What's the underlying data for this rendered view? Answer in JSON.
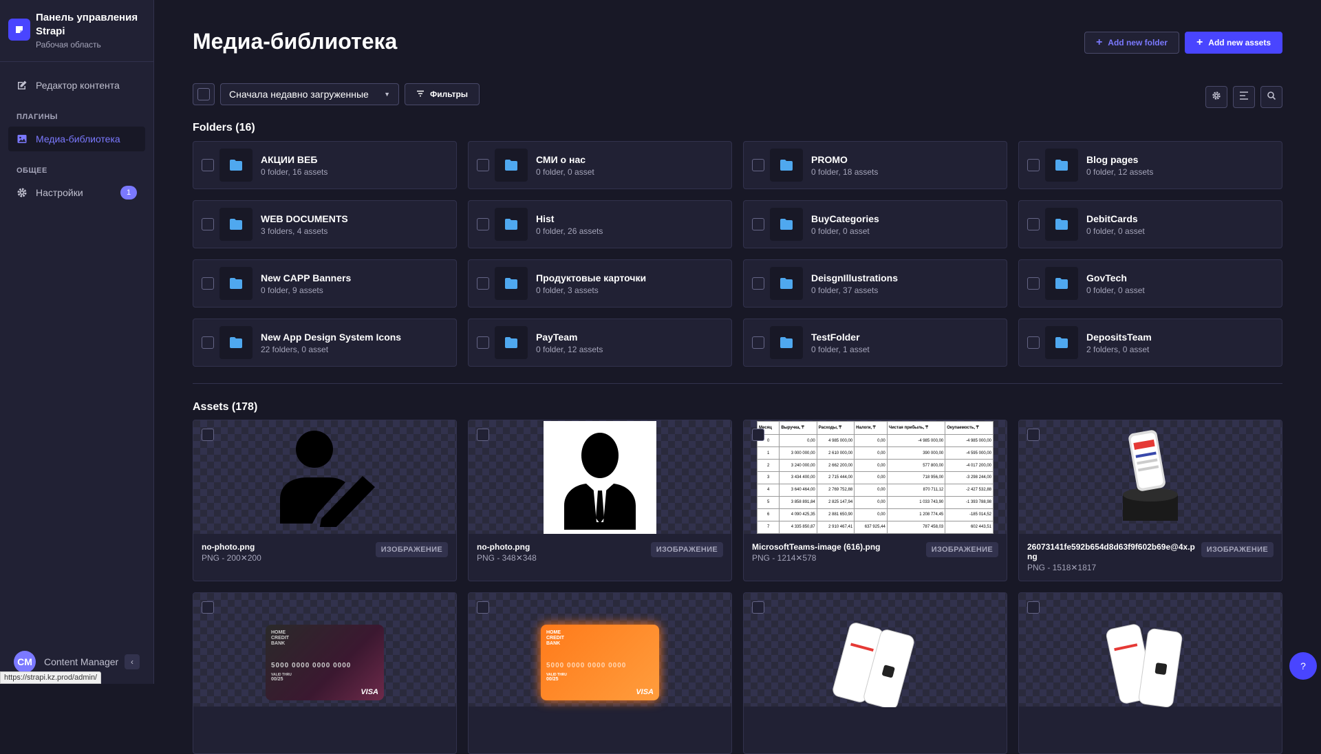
{
  "sidebar": {
    "brand_title": "Панель управления Strapi",
    "brand_subtitle": "Рабочая область",
    "content_editor": "Редактор контента",
    "section_plugins": "ПЛАГИНЫ",
    "media_library": "Медиа-библиотека",
    "section_general": "ОБЩЕЕ",
    "settings": "Настройки",
    "settings_badge": "1",
    "user_initials": "CM",
    "user_name": "Content Manager"
  },
  "status_url": "https://strapi.kz.prod/admin/",
  "header": {
    "title": "Медиа-библиотека",
    "add_folder": "Add new folder",
    "add_assets": "Add new assets"
  },
  "toolbar": {
    "sort_value": "Сначала недавно загруженные",
    "filters": "Фильтры"
  },
  "folders_title": "Folders (16)",
  "folders": [
    {
      "name": "АКЦИИ ВЕБ",
      "meta": "0 folder, 16 assets"
    },
    {
      "name": "СМИ о нас",
      "meta": "0 folder, 0 asset"
    },
    {
      "name": "PROMO",
      "meta": "0 folder, 18 assets"
    },
    {
      "name": "Blog pages",
      "meta": "0 folder, 12 assets"
    },
    {
      "name": "WEB DOCUMENTS",
      "meta": "3 folders, 4 assets"
    },
    {
      "name": "Hist",
      "meta": "0 folder, 26 assets"
    },
    {
      "name": "BuyCategories",
      "meta": "0 folder, 0 asset"
    },
    {
      "name": "DebitCards",
      "meta": "0 folder, 0 asset"
    },
    {
      "name": "New CAPP Banners",
      "meta": "0 folder, 9 assets"
    },
    {
      "name": "Продуктовые карточки",
      "meta": "0 folder, 3 assets"
    },
    {
      "name": "DeisgnIllustrations",
      "meta": "0 folder, 37 assets"
    },
    {
      "name": "GovTech",
      "meta": "0 folder, 0 asset"
    },
    {
      "name": "New App Design System Icons",
      "meta": "22 folders, 0 asset"
    },
    {
      "name": "PayTeam",
      "meta": "0 folder, 12 assets"
    },
    {
      "name": "TestFolder",
      "meta": "0 folder, 1 asset"
    },
    {
      "name": "DepositsTeam",
      "meta": "2 folders, 0 asset"
    }
  ],
  "assets_title": "Assets (178)",
  "assets": [
    {
      "name": "no-photo.png",
      "meta": "PNG - 200✕200",
      "tag": "ИЗОБРАЖЕНИЕ"
    },
    {
      "name": "no-photo.png",
      "meta": "PNG - 348✕348",
      "tag": "ИЗОБРАЖЕНИЕ"
    },
    {
      "name": "MicrosoftTeams-image (616).png",
      "meta": "PNG - 1214✕578",
      "tag": "ИЗОБРАЖЕНИЕ"
    },
    {
      "name": "26073141fe592b654d8d63f9f602b69e@4x.png",
      "meta": "PNG - 1518✕1817",
      "tag": "ИЗОБРАЖЕНИЕ"
    }
  ],
  "table_preview": {
    "headers": [
      "Месяц",
      "Выручка, ₸",
      "Расходы, ₸",
      "Налоги, ₸",
      "Чистая прибыль, ₸",
      "Окупаемость, ₸"
    ],
    "rows": [
      [
        "0",
        "0,00",
        "4 985 000,00",
        "0,00",
        "-4 985 000,00",
        "-4 985 000,00"
      ],
      [
        "1",
        "3 000 000,00",
        "2 610 000,00",
        "0,00",
        "390 000,00",
        "-4 595 000,00"
      ],
      [
        "2",
        "3 240 000,00",
        "2 662 200,00",
        "0,00",
        "577 800,00",
        "-4 017 200,00"
      ],
      [
        "3",
        "3 434 400,00",
        "2 715 444,00",
        "0,00",
        "718 956,00",
        "-3 298 244,00"
      ],
      [
        "4",
        "3 640 464,00",
        "2 769 752,88",
        "0,00",
        "870 711,12",
        "-2 427 532,88"
      ],
      [
        "5",
        "3 858 891,84",
        "2 825 147,94",
        "0,00",
        "1 033 743,90",
        "-1 393 788,98"
      ],
      [
        "6",
        "4 090 425,35",
        "2 881 650,90",
        "0,00",
        "1 208 774,45",
        "-185 014,52"
      ],
      [
        "7",
        "4 335 850,87",
        "2 910 467,41",
        "637 925,44",
        "787 458,03",
        "602 443,51"
      ]
    ]
  },
  "card_preview": {
    "bank_text": "HOME CREDIT BANK",
    "number": "5000 0000 0000 0000",
    "visa": "VISA",
    "valid": "VALID THRU",
    "expiry": "00/25"
  },
  "colors": {
    "accent": "#4945ff",
    "folder": "#4fa8ef",
    "bg": "#181826",
    "panel": "#212134"
  }
}
